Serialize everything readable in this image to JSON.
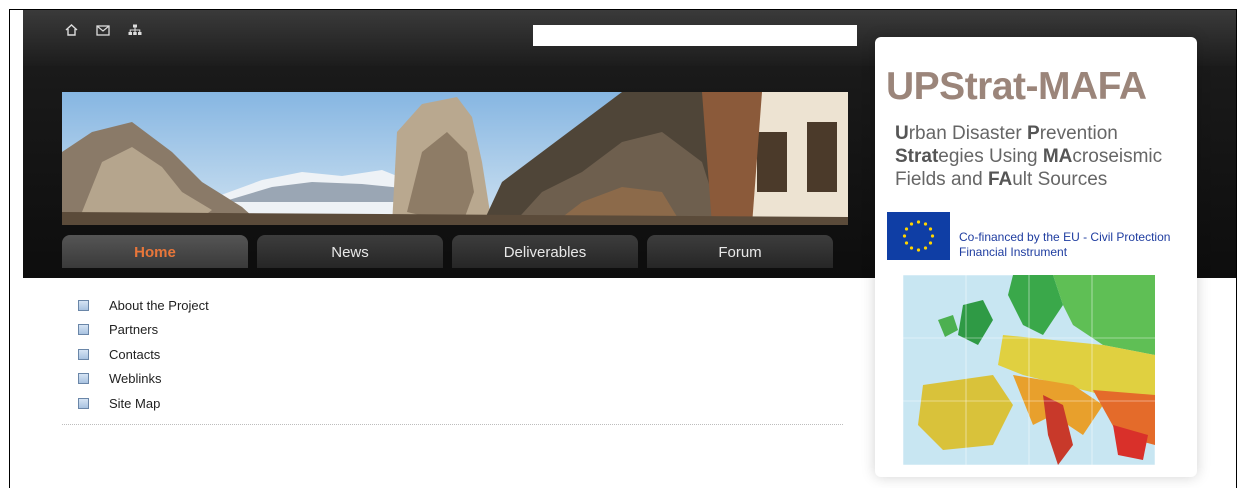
{
  "search": {
    "value": "",
    "placeholder": ""
  },
  "topbar_icons": [
    "home-icon",
    "mail-icon",
    "sitemap-icon"
  ],
  "nav": {
    "tabs": [
      {
        "label": "Home",
        "active": true
      },
      {
        "label": "News",
        "active": false
      },
      {
        "label": "Deliverables",
        "active": false
      },
      {
        "label": "Forum",
        "active": false
      }
    ]
  },
  "menu": {
    "items": [
      {
        "label": "About the Project"
      },
      {
        "label": "Partners"
      },
      {
        "label": "Contacts"
      },
      {
        "label": "Weblinks"
      },
      {
        "label": "Site Map"
      }
    ]
  },
  "panel": {
    "title": "UPStrat-MAFA",
    "subtitle": {
      "line1_b1": "U",
      "line1_r1": "rban Disaster ",
      "line1_b2": "P",
      "line1_r2": "revention",
      "line2_b1": "Strat",
      "line2_r1": "egies Using ",
      "line2_b2": "MA",
      "line2_r2": "croseismic",
      "line3_r1": "Fields and ",
      "line3_b1": "FA",
      "line3_r2": "ult Sources"
    },
    "eu": {
      "line1": "Co-financed by the EU - Civil Protection",
      "line2": "Financial Instrument"
    }
  },
  "colors": {
    "active_tab": "#e8763a",
    "eu_blue": "#0f3ea5",
    "eu_text": "#1f3da0",
    "title": "#9b857a"
  }
}
